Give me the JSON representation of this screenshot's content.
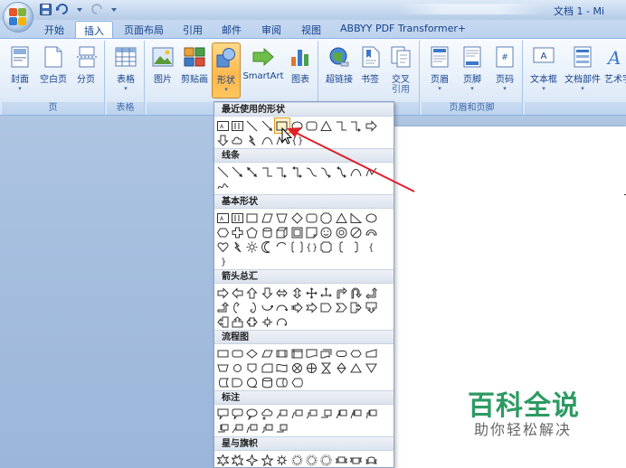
{
  "window": {
    "title": "文档 1 - Mi"
  },
  "tabs": [
    {
      "label": "开始",
      "active": false
    },
    {
      "label": "插入",
      "active": true
    },
    {
      "label": "页面布局",
      "active": false
    },
    {
      "label": "引用",
      "active": false
    },
    {
      "label": "邮件",
      "active": false
    },
    {
      "label": "审阅",
      "active": false
    },
    {
      "label": "视图",
      "active": false
    },
    {
      "label": "ABBYY PDF Transformer+",
      "active": false
    }
  ],
  "ribbon": {
    "groups": {
      "pages": {
        "label": "页",
        "buttons": [
          "封面",
          "空白页",
          "分页"
        ]
      },
      "tables": {
        "label": "表格",
        "buttons": [
          "表格"
        ]
      },
      "illustrations": {
        "buttons": [
          "图片",
          "剪贴画",
          "形状",
          "SmartArt",
          "图表"
        ]
      },
      "links": {
        "buttons": [
          "超链接",
          "书签",
          "交叉",
          "引用"
        ]
      },
      "header_footer": {
        "label": "页眉和页脚",
        "buttons": [
          "页眉",
          "页脚",
          "页码"
        ]
      },
      "text": {
        "buttons": [
          "文本框",
          "文档部件",
          "艺术字"
        ]
      }
    }
  },
  "shapes_panel": {
    "sections": {
      "recent": "最近使用的形状",
      "lines": "线条",
      "basic": "基本形状",
      "arrows": "箭头总汇",
      "flowchart": "流程图",
      "callouts": "标注",
      "stars": "星与旗帜"
    }
  },
  "watermark": {
    "title": "百科全说",
    "subtitle": "助你轻松解决"
  },
  "colors": {
    "accent": "#15428b",
    "pressed": "#ffb84d",
    "annotation": "#e0202a",
    "watermark": "#2d9a62"
  }
}
